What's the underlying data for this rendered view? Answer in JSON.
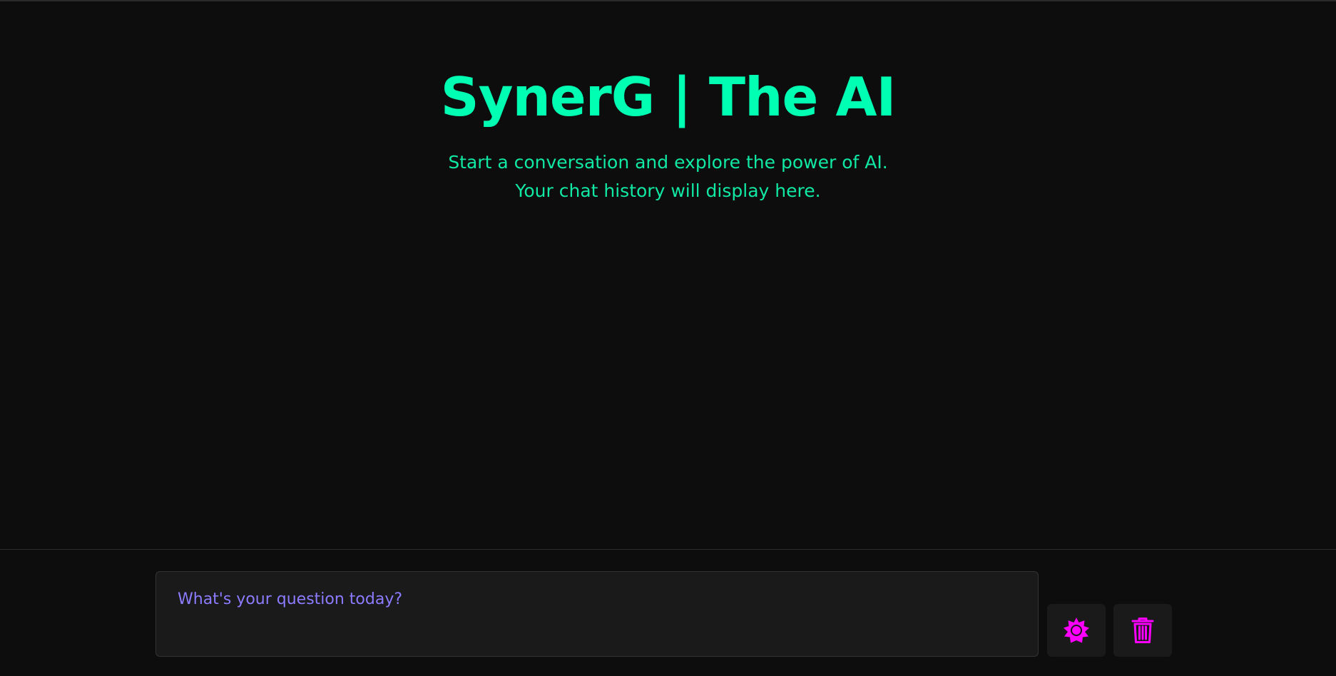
{
  "app": {
    "title": "SynerG | The AI",
    "subtitle_lines": [
      "Start a conversation and explore the power of AI.",
      "Your chat history will display here."
    ]
  },
  "composer": {
    "input_value": "",
    "input_placeholder": "What's your question today?"
  },
  "actions": {
    "theme_toggle_icon": "sun-icon",
    "clear_chat_icon": "trash-icon"
  },
  "colors": {
    "background": "#0d0d0d",
    "accent": "#00ffb3",
    "placeholder": "#8b7cff",
    "icon": "#ff00ff",
    "panel": "#1a1a1a"
  }
}
